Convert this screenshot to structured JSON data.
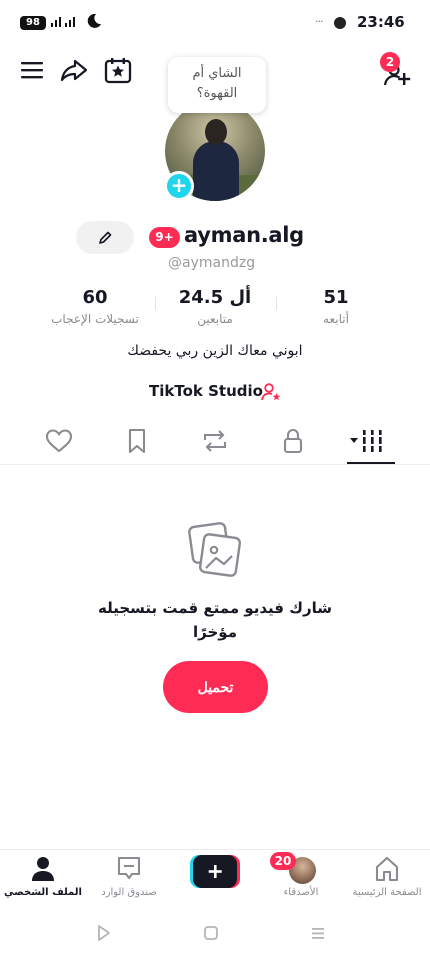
{
  "status_bar": {
    "battery": "98",
    "signal": "⸜⸝",
    "time": "23:46",
    "dots": "···"
  },
  "top_bar": {
    "icons": [
      "menu-icon",
      "share-icon",
      "calendar-star-icon",
      "add-friend-icon"
    ],
    "notification_count": "2"
  },
  "profile": {
    "bubble_text_line1": "الشاي أم",
    "bubble_text_line2": "القهوة؟",
    "level_badge": "9+",
    "username": "ayman.alg",
    "handle": "@aymandzg",
    "stats": {
      "likes_value": "60",
      "likes_label": "تسجيلات الإعجاب",
      "followers_value": "24.5 أل",
      "followers_label": "متابعين",
      "following_value": "51",
      "following_label": "أتابعه"
    },
    "bio": "ابوني معاك الزين ربي يحفضك",
    "studio_link": "TikTok Studio"
  },
  "tabs": [
    "heart-tab",
    "bookmark-tab",
    "repost-tab",
    "lock-tab",
    "grid-tab"
  ],
  "empty_state": {
    "line1": "شارك فيديو ممتع قمت بتسجيله",
    "line2": "مؤخرًا",
    "button": "تحميل"
  },
  "bottom_nav": {
    "home": "الصفحة الرئيسية",
    "friends": "الأصدقاء",
    "friends_badge": "20",
    "inbox": "صندوق الوارد",
    "profile": "الملف الشخصي"
  },
  "colors": {
    "accent": "#fe2c55",
    "cyan": "#20d5ec",
    "text": "#161823",
    "muted": "#8a8b91"
  }
}
